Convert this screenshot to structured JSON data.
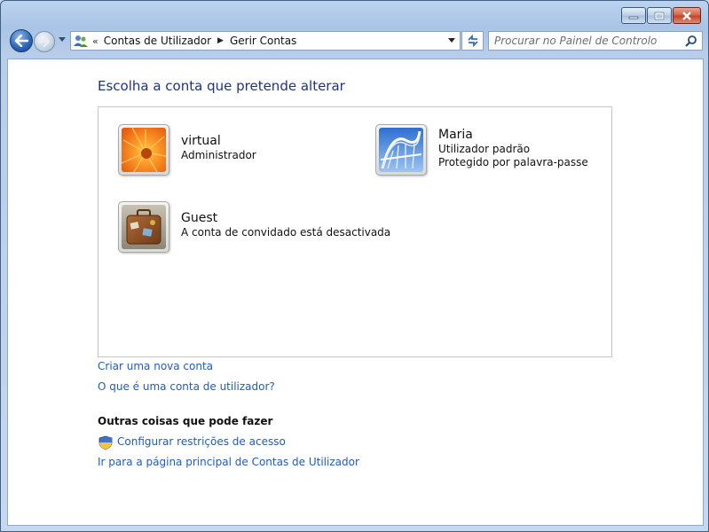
{
  "navigation": {
    "breadcrumb_overflow": "«",
    "breadcrumbs": [
      "Contas de Utilizador",
      "Gerir Contas"
    ],
    "search_placeholder": "Procurar no Painel de Controlo"
  },
  "main": {
    "heading": "Escolha a conta que pretende alterar",
    "accounts": [
      {
        "name": "virtual",
        "lines": [
          "Administrador"
        ],
        "picture": "orange-flower-picture"
      },
      {
        "name": "Maria",
        "lines": [
          "Utilizador padrão",
          "Protegido por palavra-passe"
        ],
        "picture": "rollercoaster-picture"
      },
      {
        "name": "Guest",
        "lines": [
          "A conta de convidado está desactivada"
        ],
        "picture": "suitcase-picture"
      }
    ],
    "links": {
      "create_account": "Criar uma nova conta",
      "what_is_account": "O que é uma conta de utilizador?"
    },
    "other_things": {
      "title": "Outras coisas que pode fazer",
      "parental_controls": "Configurar restrições de acesso",
      "main_page": "Ir para a página principal de Contas de Utilizador"
    }
  },
  "icons": [
    "minimize-icon",
    "maximize-icon",
    "close-icon",
    "back-arrow-icon",
    "forward-arrow-icon",
    "users-folder-icon",
    "refresh-icon",
    "search-icon",
    "shield-icon"
  ],
  "colors": {
    "link": "#1e5cbf",
    "heading": "#1e3287",
    "close_button": "#c0422b"
  }
}
